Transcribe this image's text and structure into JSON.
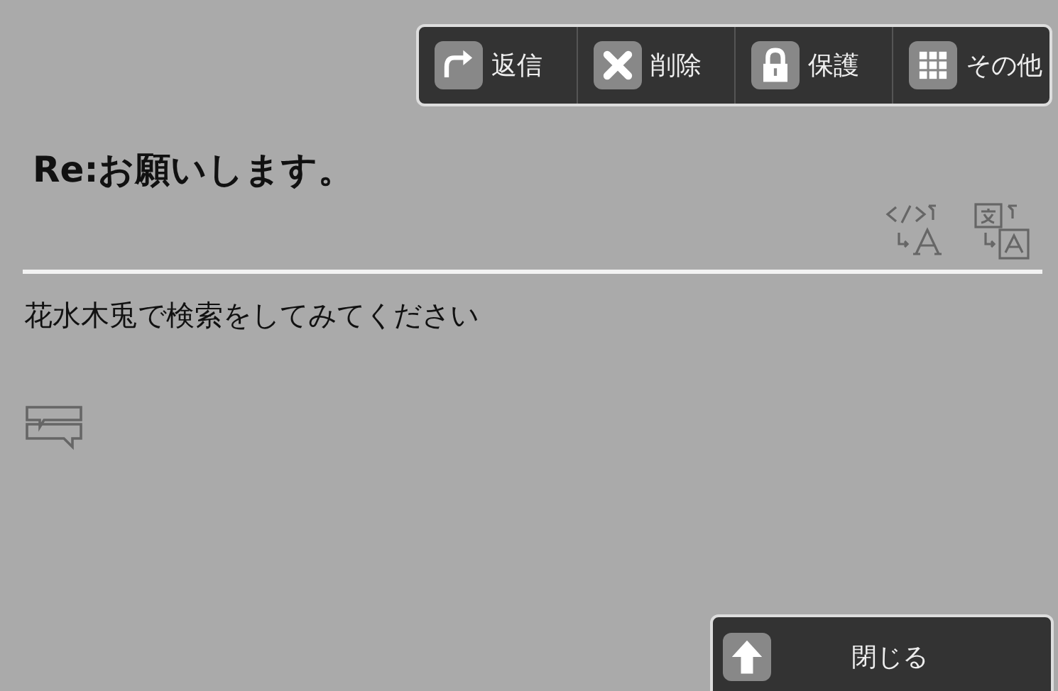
{
  "toolbar": [
    {
      "kind": "reply",
      "label": "返信"
    },
    {
      "kind": "delete",
      "label": "削除"
    },
    {
      "kind": "protect",
      "label": "保護"
    },
    {
      "kind": "more",
      "label": "その他"
    }
  ],
  "title": "Re:お願いします。",
  "body": "花水木兎で検索をしてみてください",
  "close_button": {
    "label": "閉じる"
  }
}
